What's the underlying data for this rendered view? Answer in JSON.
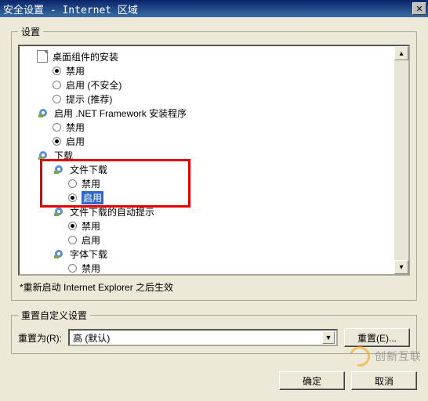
{
  "window": {
    "title": "安全设置 - Internet 区域",
    "close": "✕"
  },
  "settings": {
    "legend": "设置",
    "items": {
      "desktop_install": "桌面组件的安装",
      "disable": "禁用",
      "enable_unsafe": "启用 (不安全)",
      "prompt_recommended": "提示 (推荐)",
      "net_framework": "启用 .NET Framework 安装程序",
      "enable": "启用",
      "downloads": "下载",
      "file_download": "文件下载",
      "auto_prompt": "文件下载的自动提示",
      "font_download": "字体下载"
    },
    "note": "*重新启动 Internet Explorer 之后生效"
  },
  "reset": {
    "legend": "重置自定义设置",
    "label": "重置为(R):",
    "value": "高 (默认)",
    "button": "重置(E)..."
  },
  "buttons": {
    "ok": "确定",
    "cancel": "取消"
  },
  "watermark": "创新互联"
}
